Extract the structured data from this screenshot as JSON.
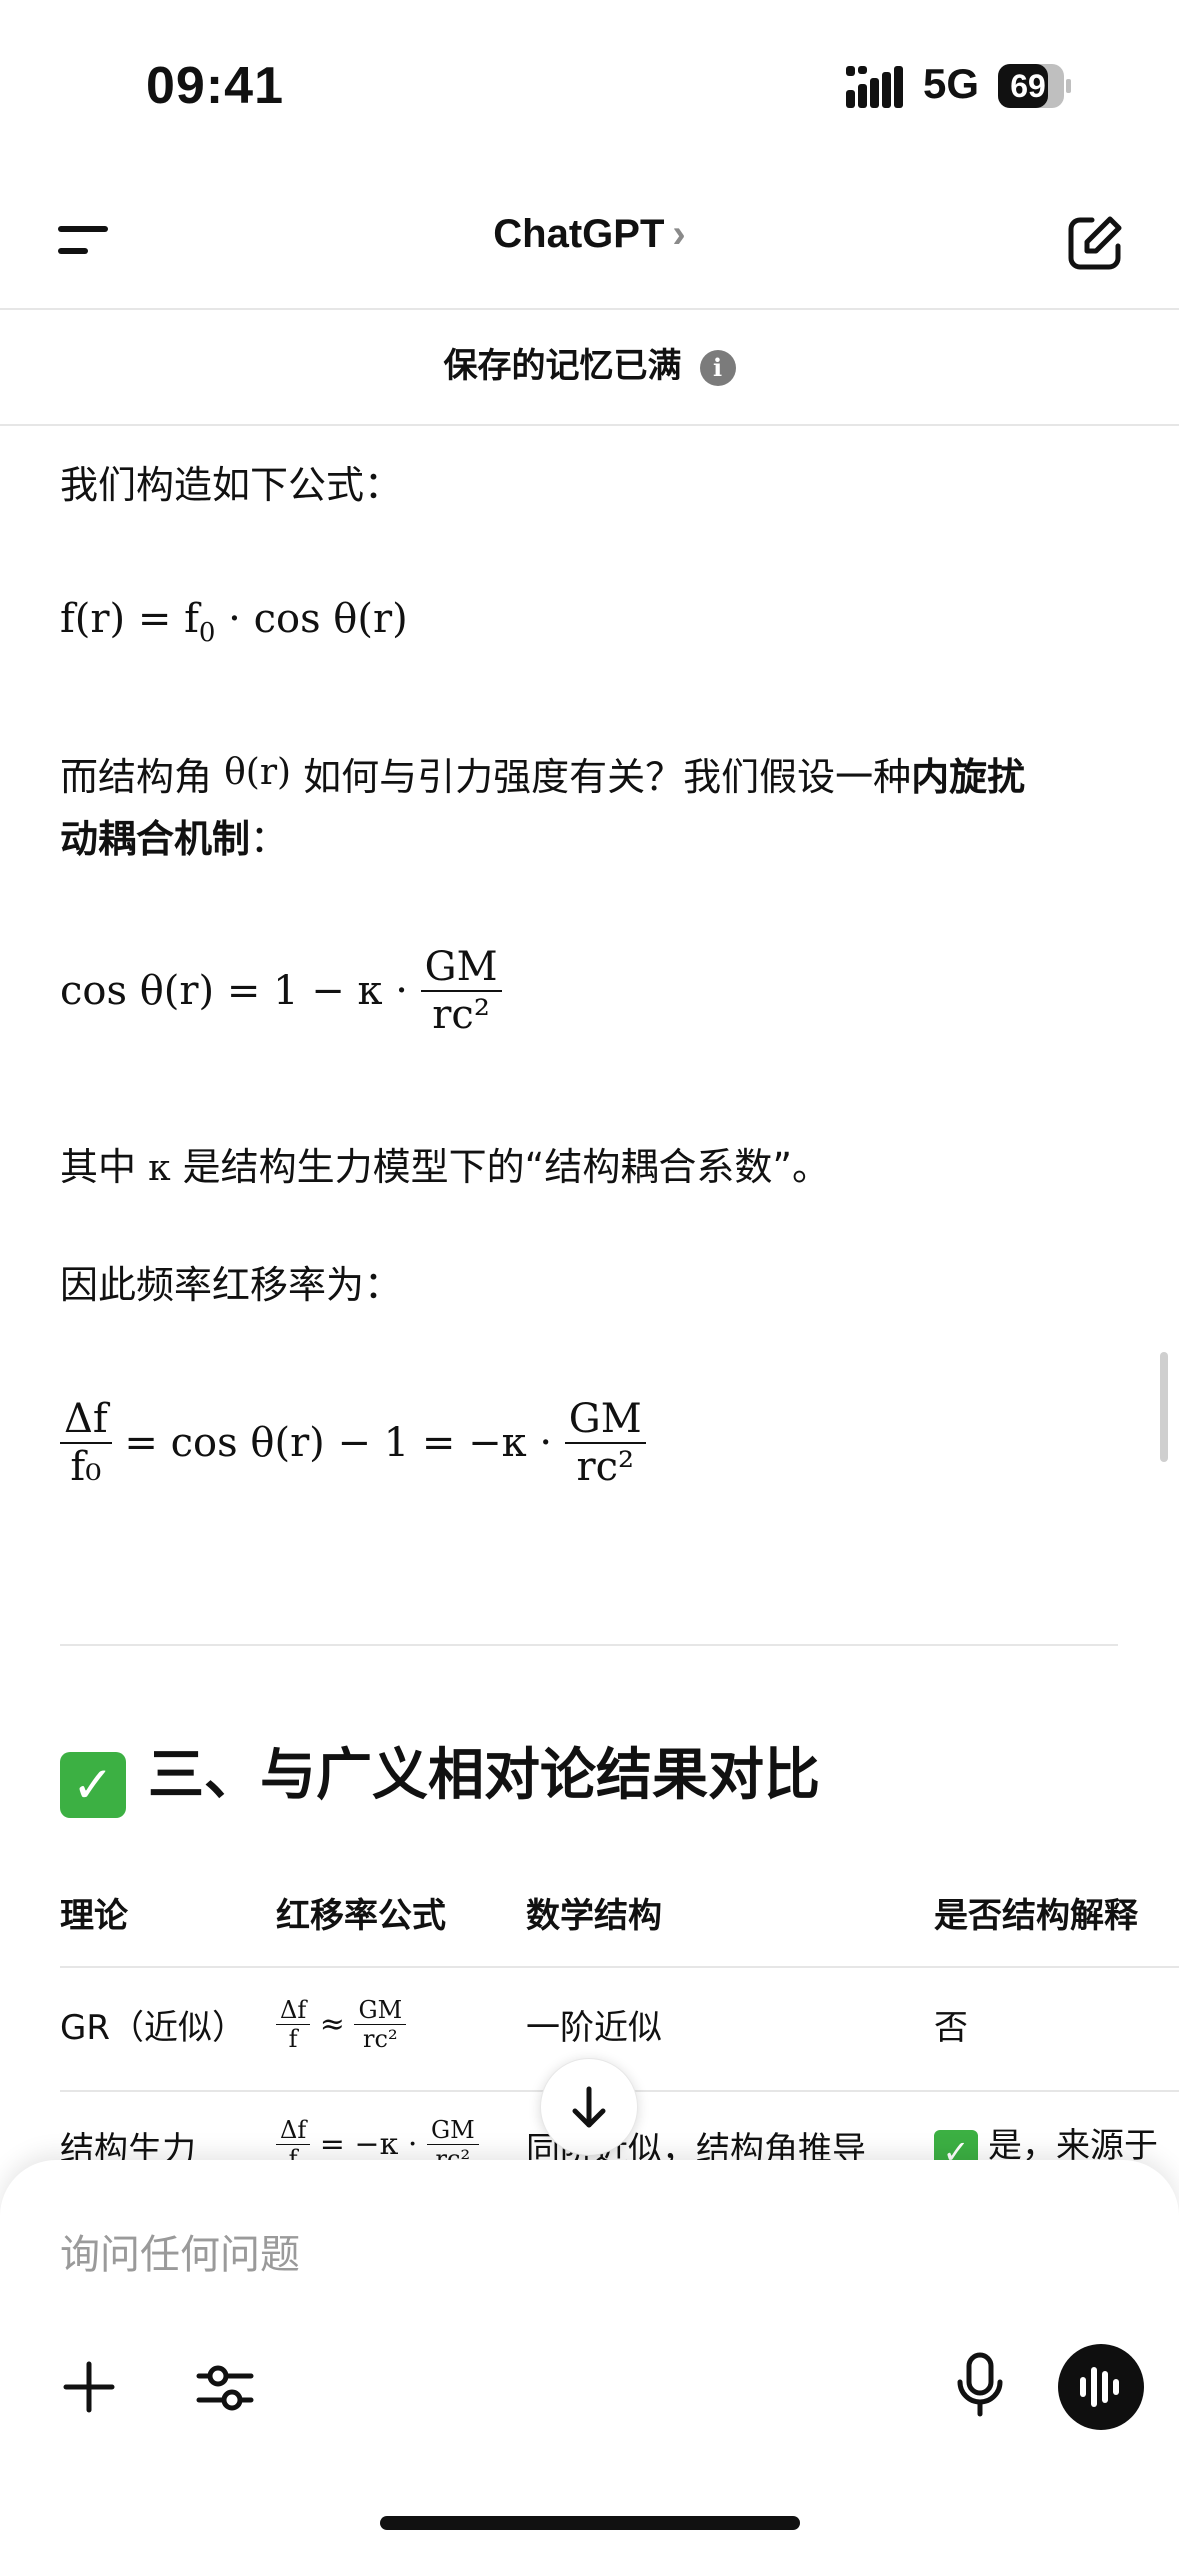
{
  "status_bar": {
    "time": "09:41",
    "network": "5G",
    "battery": "69"
  },
  "header": {
    "title": "ChatGPT",
    "title_chevron": "›"
  },
  "banner": {
    "text": "保存的记忆已满",
    "info": "i"
  },
  "content": {
    "p1": "我们构造如下公式：",
    "eq1": {
      "lhs": "f(r) = f",
      "sub": "0",
      "rhs": " · cos θ(r)"
    },
    "p2_a": "而结构角 ",
    "p2_math": "θ(r)",
    "p2_b": " 如何与引力强度有关？我们假设一种",
    "p2_bold1": "内旋扰",
    "p2_bold2": "动耦合机制",
    "p2_c": "：",
    "eq2": {
      "lhs": "cos θ(r) = 1 − κ · ",
      "num": "GM",
      "den": "rc²"
    },
    "p3_a": "其中 ",
    "p3_math": "κ",
    "p3_b": " 是结构生力模型下的“结构耦合系数”。",
    "p4": "因此频率红移率为：",
    "eq3": {
      "num": "Δf",
      "den": "f₀",
      "mid": " = cos θ(r) − 1 = −κ · ",
      "num2": "GM",
      "den2": "rc²"
    },
    "section_title": "三、与广义相对论结果对比",
    "table": {
      "headers": [
        "理论",
        "红移率公式",
        "数学结构",
        "是否结构解释"
      ],
      "rows": [
        {
          "theory": "GR（近似）",
          "formula_num": "Δf",
          "formula_den": "f",
          "formula_op": " ≈ ",
          "formula_num2": "GM",
          "formula_den2": "rc²",
          "structure": "一阶近似",
          "explain": "否"
        },
        {
          "theory": "结构生力",
          "formula_num": "Δf",
          "formula_den": "f",
          "formula_op": " = −κ · ",
          "formula_num2": "GM",
          "formula_den2": "rc²",
          "structure": "同阶近似，结构角推导",
          "explain": "是，来源于"
        }
      ]
    }
  },
  "composer": {
    "placeholder": "询问任何问题"
  }
}
